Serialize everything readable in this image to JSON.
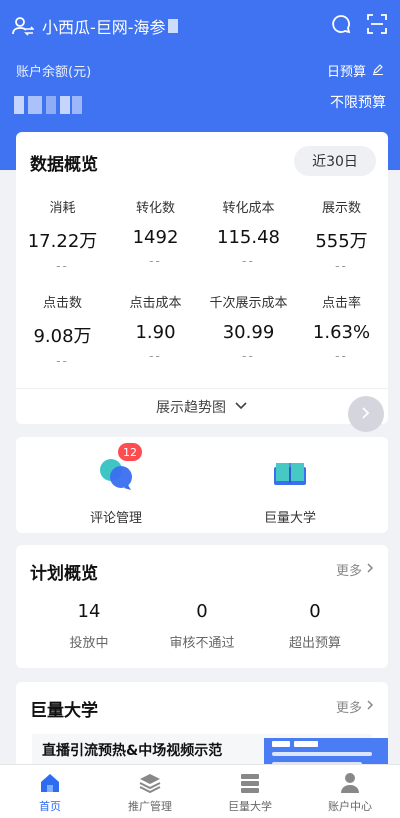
{
  "header": {
    "account_name": "小西瓜-巨网-海参",
    "balance_label": "账户余额(元)",
    "budget_label": "日预算",
    "budget_value": "不限预算"
  },
  "overview": {
    "title": "数据概览",
    "period": "近30日",
    "metrics": [
      {
        "label": "消耗",
        "value": "17.22万",
        "delta": "--"
      },
      {
        "label": "转化数",
        "value": "1492",
        "delta": "--"
      },
      {
        "label": "转化成本",
        "value": "115.48",
        "delta": "--"
      },
      {
        "label": "展示数",
        "value": "555万",
        "delta": "--"
      },
      {
        "label": "点击数",
        "value": "9.08万",
        "delta": "--"
      },
      {
        "label": "点击成本",
        "value": "1.90",
        "delta": "--"
      },
      {
        "label": "千次展示成本",
        "value": "30.99",
        "delta": "--"
      },
      {
        "label": "点击率",
        "value": "1.63%",
        "delta": "--"
      }
    ],
    "trend_toggle": "展示趋势图"
  },
  "tools": {
    "comments": {
      "label": "评论管理",
      "badge": "12"
    },
    "academy": {
      "label": "巨量大学"
    }
  },
  "plan": {
    "title": "计划概览",
    "more": "更多",
    "stats": [
      {
        "value": "14",
        "label": "投放中"
      },
      {
        "value": "0",
        "label": "审核不通过"
      },
      {
        "value": "0",
        "label": "超出预算"
      }
    ]
  },
  "academy": {
    "title": "巨量大学",
    "more": "更多",
    "article_title": "直播引流预热&中场视频示范"
  },
  "tabbar": {
    "items": [
      {
        "label": "首页",
        "icon": "home-icon"
      },
      {
        "label": "推广管理",
        "icon": "layers-icon"
      },
      {
        "label": "巨量大学",
        "icon": "book-stack-icon"
      },
      {
        "label": "账户中心",
        "icon": "user-icon"
      }
    ],
    "active": "首页"
  },
  "colors": {
    "brand_blue": "#3f73f2",
    "badge_red": "#ff4d4f",
    "active_tab": "#2f6bf0"
  }
}
